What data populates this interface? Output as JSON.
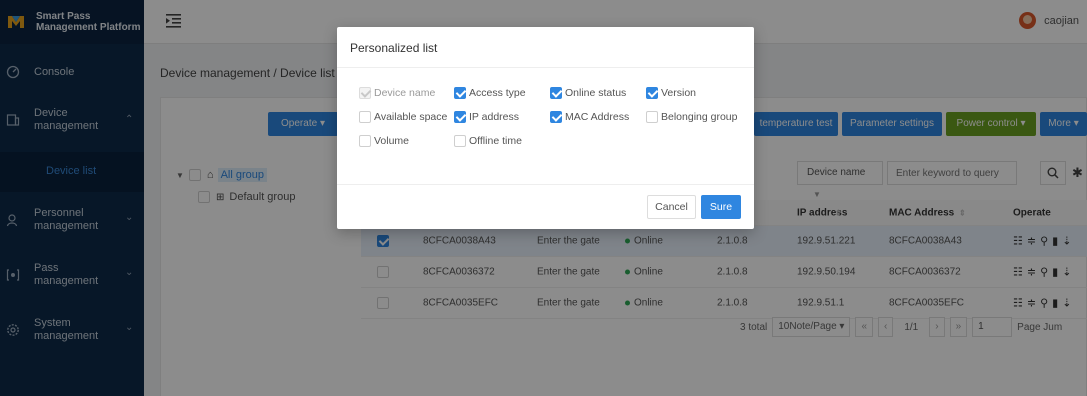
{
  "brand": {
    "title_line1": "Smart Pass",
    "title_line2": "Management Platform"
  },
  "sidebar": {
    "items": [
      {
        "label": "Console",
        "icon": "dashboard-icon"
      },
      {
        "label": "Device management",
        "icon": "device-icon",
        "expanded": true
      },
      {
        "label": "Personnel management",
        "icon": "person-icon"
      },
      {
        "label": "Pass management",
        "icon": "pass-icon"
      },
      {
        "label": "System management",
        "icon": "settings-icon"
      }
    ],
    "sub_item": "Device list"
  },
  "header": {
    "username": "caojian"
  },
  "breadcrumb": "Device management / Device list",
  "toolbar": {
    "operate": "Operate ▾",
    "temperature_test": "temperature test",
    "parameter_settings": "Parameter settings",
    "power_control": "Power control ▾",
    "more": "More ▾"
  },
  "tree": {
    "root": "All group",
    "child": "Default group"
  },
  "search": {
    "field": "Device name",
    "placeholder": "Enter keyword to query"
  },
  "table": {
    "headers": {
      "ip": "IP address",
      "mac": "MAC Address",
      "operate": "Operate"
    },
    "rows": [
      {
        "sn": "8CFCA0038A43",
        "access": "Enter the gate",
        "status": "Online",
        "version": "2.1.0.8",
        "ip": "192.9.51.221",
        "mac": "8CFCA0038A43",
        "selected": true
      },
      {
        "sn": "8CFCA0036372",
        "access": "Enter the gate",
        "status": "Online",
        "version": "2.1.0.8",
        "ip": "192.9.50.194",
        "mac": "8CFCA0036372",
        "selected": false
      },
      {
        "sn": "8CFCA0035EFC",
        "access": "Enter the gate",
        "status": "Online",
        "version": "2.1.0.8",
        "ip": "192.9.51.1",
        "mac": "8CFCA0035EFC",
        "selected": false
      }
    ]
  },
  "pager": {
    "total": "3 total",
    "page_size": "10Note/Page ▾",
    "page": "1/1",
    "jump_value": "1",
    "jump_label": "Page Jum"
  },
  "modal": {
    "title": "Personalized list",
    "options": [
      {
        "label": "Device name",
        "state": "disabled-checked"
      },
      {
        "label": "Access type",
        "state": "checked"
      },
      {
        "label": "Online status",
        "state": "checked"
      },
      {
        "label": "Version",
        "state": "checked"
      },
      {
        "label": "Available space",
        "state": "unchecked"
      },
      {
        "label": "IP address",
        "state": "checked"
      },
      {
        "label": "MAC Address",
        "state": "checked"
      },
      {
        "label": "Belonging group",
        "state": "unchecked"
      },
      {
        "label": "Volume",
        "state": "unchecked"
      },
      {
        "label": "Offline time",
        "state": "unchecked"
      }
    ],
    "cancel": "Cancel",
    "sure": "Sure"
  },
  "colors": {
    "primary": "#2f86e0",
    "sidebar": "#0d2b4a",
    "green_btn": "#6aa121",
    "online": "#2eaa56"
  }
}
